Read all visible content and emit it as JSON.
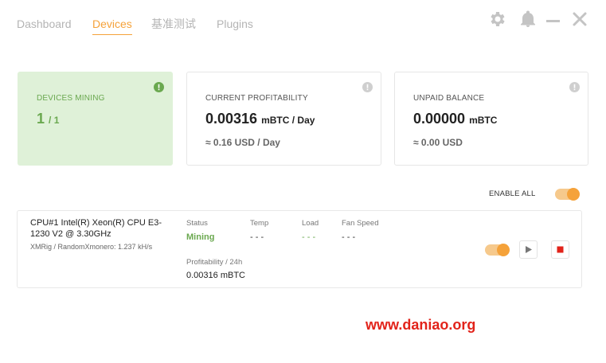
{
  "nav": {
    "tabs": [
      {
        "label": "Dashboard",
        "active": false
      },
      {
        "label": "Devices",
        "active": true
      },
      {
        "label": "基准测试",
        "active": false
      },
      {
        "label": "Plugins",
        "active": false
      }
    ]
  },
  "window_icons": [
    "gear-icon",
    "bell-icon",
    "minimize-icon",
    "close-icon"
  ],
  "cards": {
    "devices_mining": {
      "label": "DEVICES MINING",
      "value": "1",
      "total": "/ 1"
    },
    "profitability": {
      "label": "CURRENT PROFITABILITY",
      "value": "0.00316",
      "unit": "mBTC / Day",
      "sub": "≈ 0.16 USD / Day"
    },
    "balance": {
      "label": "UNPAID BALANCE",
      "value": "0.00000",
      "unit": "mBTC",
      "sub": "≈ 0.00 USD"
    }
  },
  "enable_all": {
    "label": "ENABLE ALL",
    "on": true
  },
  "device": {
    "name": "CPU#1 Intel(R) Xeon(R) CPU E3-1230 V2 @ 3.30GHz",
    "algo": "XMRig / RandomXmonero: 1.237 kH/s",
    "status": {
      "label": "Status",
      "value": "Mining"
    },
    "temp": {
      "label": "Temp",
      "value": "- - -"
    },
    "load": {
      "label": "Load",
      "value": "- - -"
    },
    "fan": {
      "label": "Fan Speed",
      "value": "- - -"
    },
    "profitability": {
      "label": "Profitability / 24h",
      "value": "0.00316 mBTC"
    },
    "enabled": true
  },
  "watermark": "www.daniao.org",
  "colors": {
    "accent": "#f5a23a",
    "green": "#6aa84f",
    "green_bg": "#dff1d8",
    "stop": "#e2231a"
  }
}
